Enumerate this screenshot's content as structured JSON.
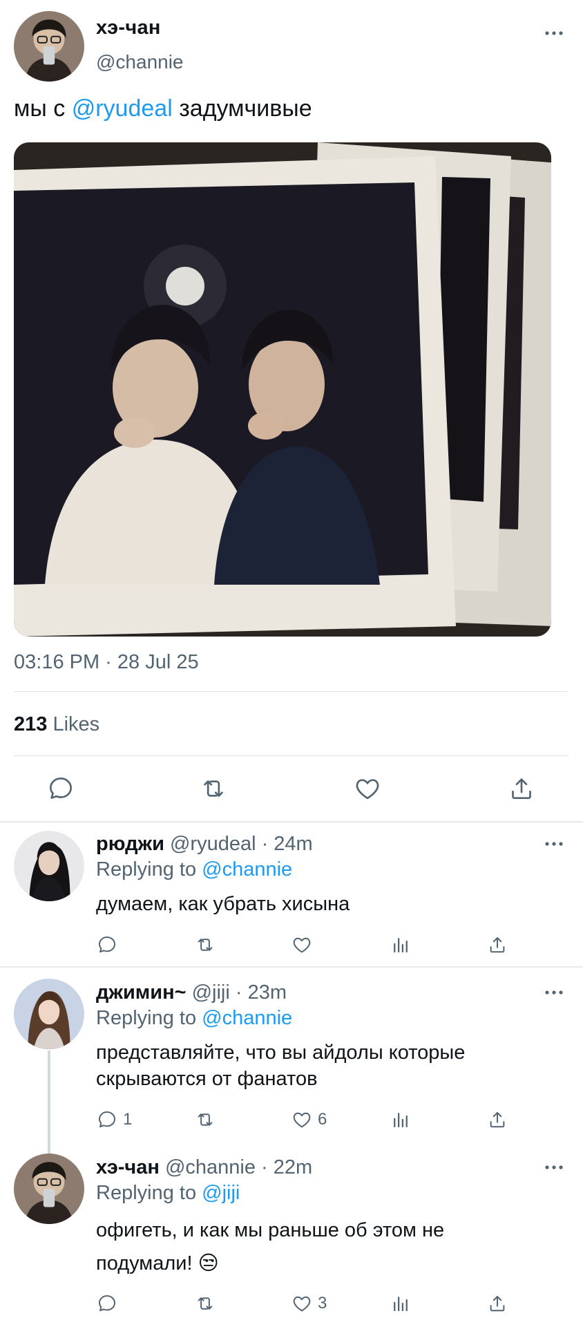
{
  "tweet": {
    "author_name": "хэ-чан",
    "author_handle": "@channie",
    "text_before": "мы с ",
    "mention": "@ryudeal",
    "text_after": " задумчивые",
    "timestamp": "03:16 PM · 28 Jul 25",
    "likes_count": "213",
    "likes_label": "Likes"
  },
  "replies": [
    {
      "name": "рюджи",
      "handle_time": "@ryudeal · 24m",
      "replying_prefix": "Replying to ",
      "replying_to": "@channie",
      "text": "думаем, как убрать хисына",
      "reply_count": "",
      "like_count": ""
    },
    {
      "name": "джимин~",
      "handle_time": "@jiji · 23m",
      "replying_prefix": "Replying to ",
      "replying_to": "@channie",
      "text_line1": "представляйте, что вы айдолы которые",
      "text_line2": "скрываются от фанатов",
      "reply_count": "1",
      "like_count": "6"
    },
    {
      "name": "хэ-чан",
      "handle_time": "@channie · 22m",
      "replying_prefix": "Replying to ",
      "replying_to": "@jiji",
      "text_line1": "офигеть, и как мы раньше об этом не",
      "text_line2": "подумали! 😒",
      "reply_count": "",
      "like_count": "3"
    }
  ],
  "colors": {
    "accent": "#1d9bf0",
    "secondary_text": "#536471",
    "primary_text": "#0f1419"
  },
  "icons": [
    "more-icon",
    "reply-icon",
    "retweet-icon",
    "like-icon",
    "views-icon",
    "share-icon"
  ]
}
